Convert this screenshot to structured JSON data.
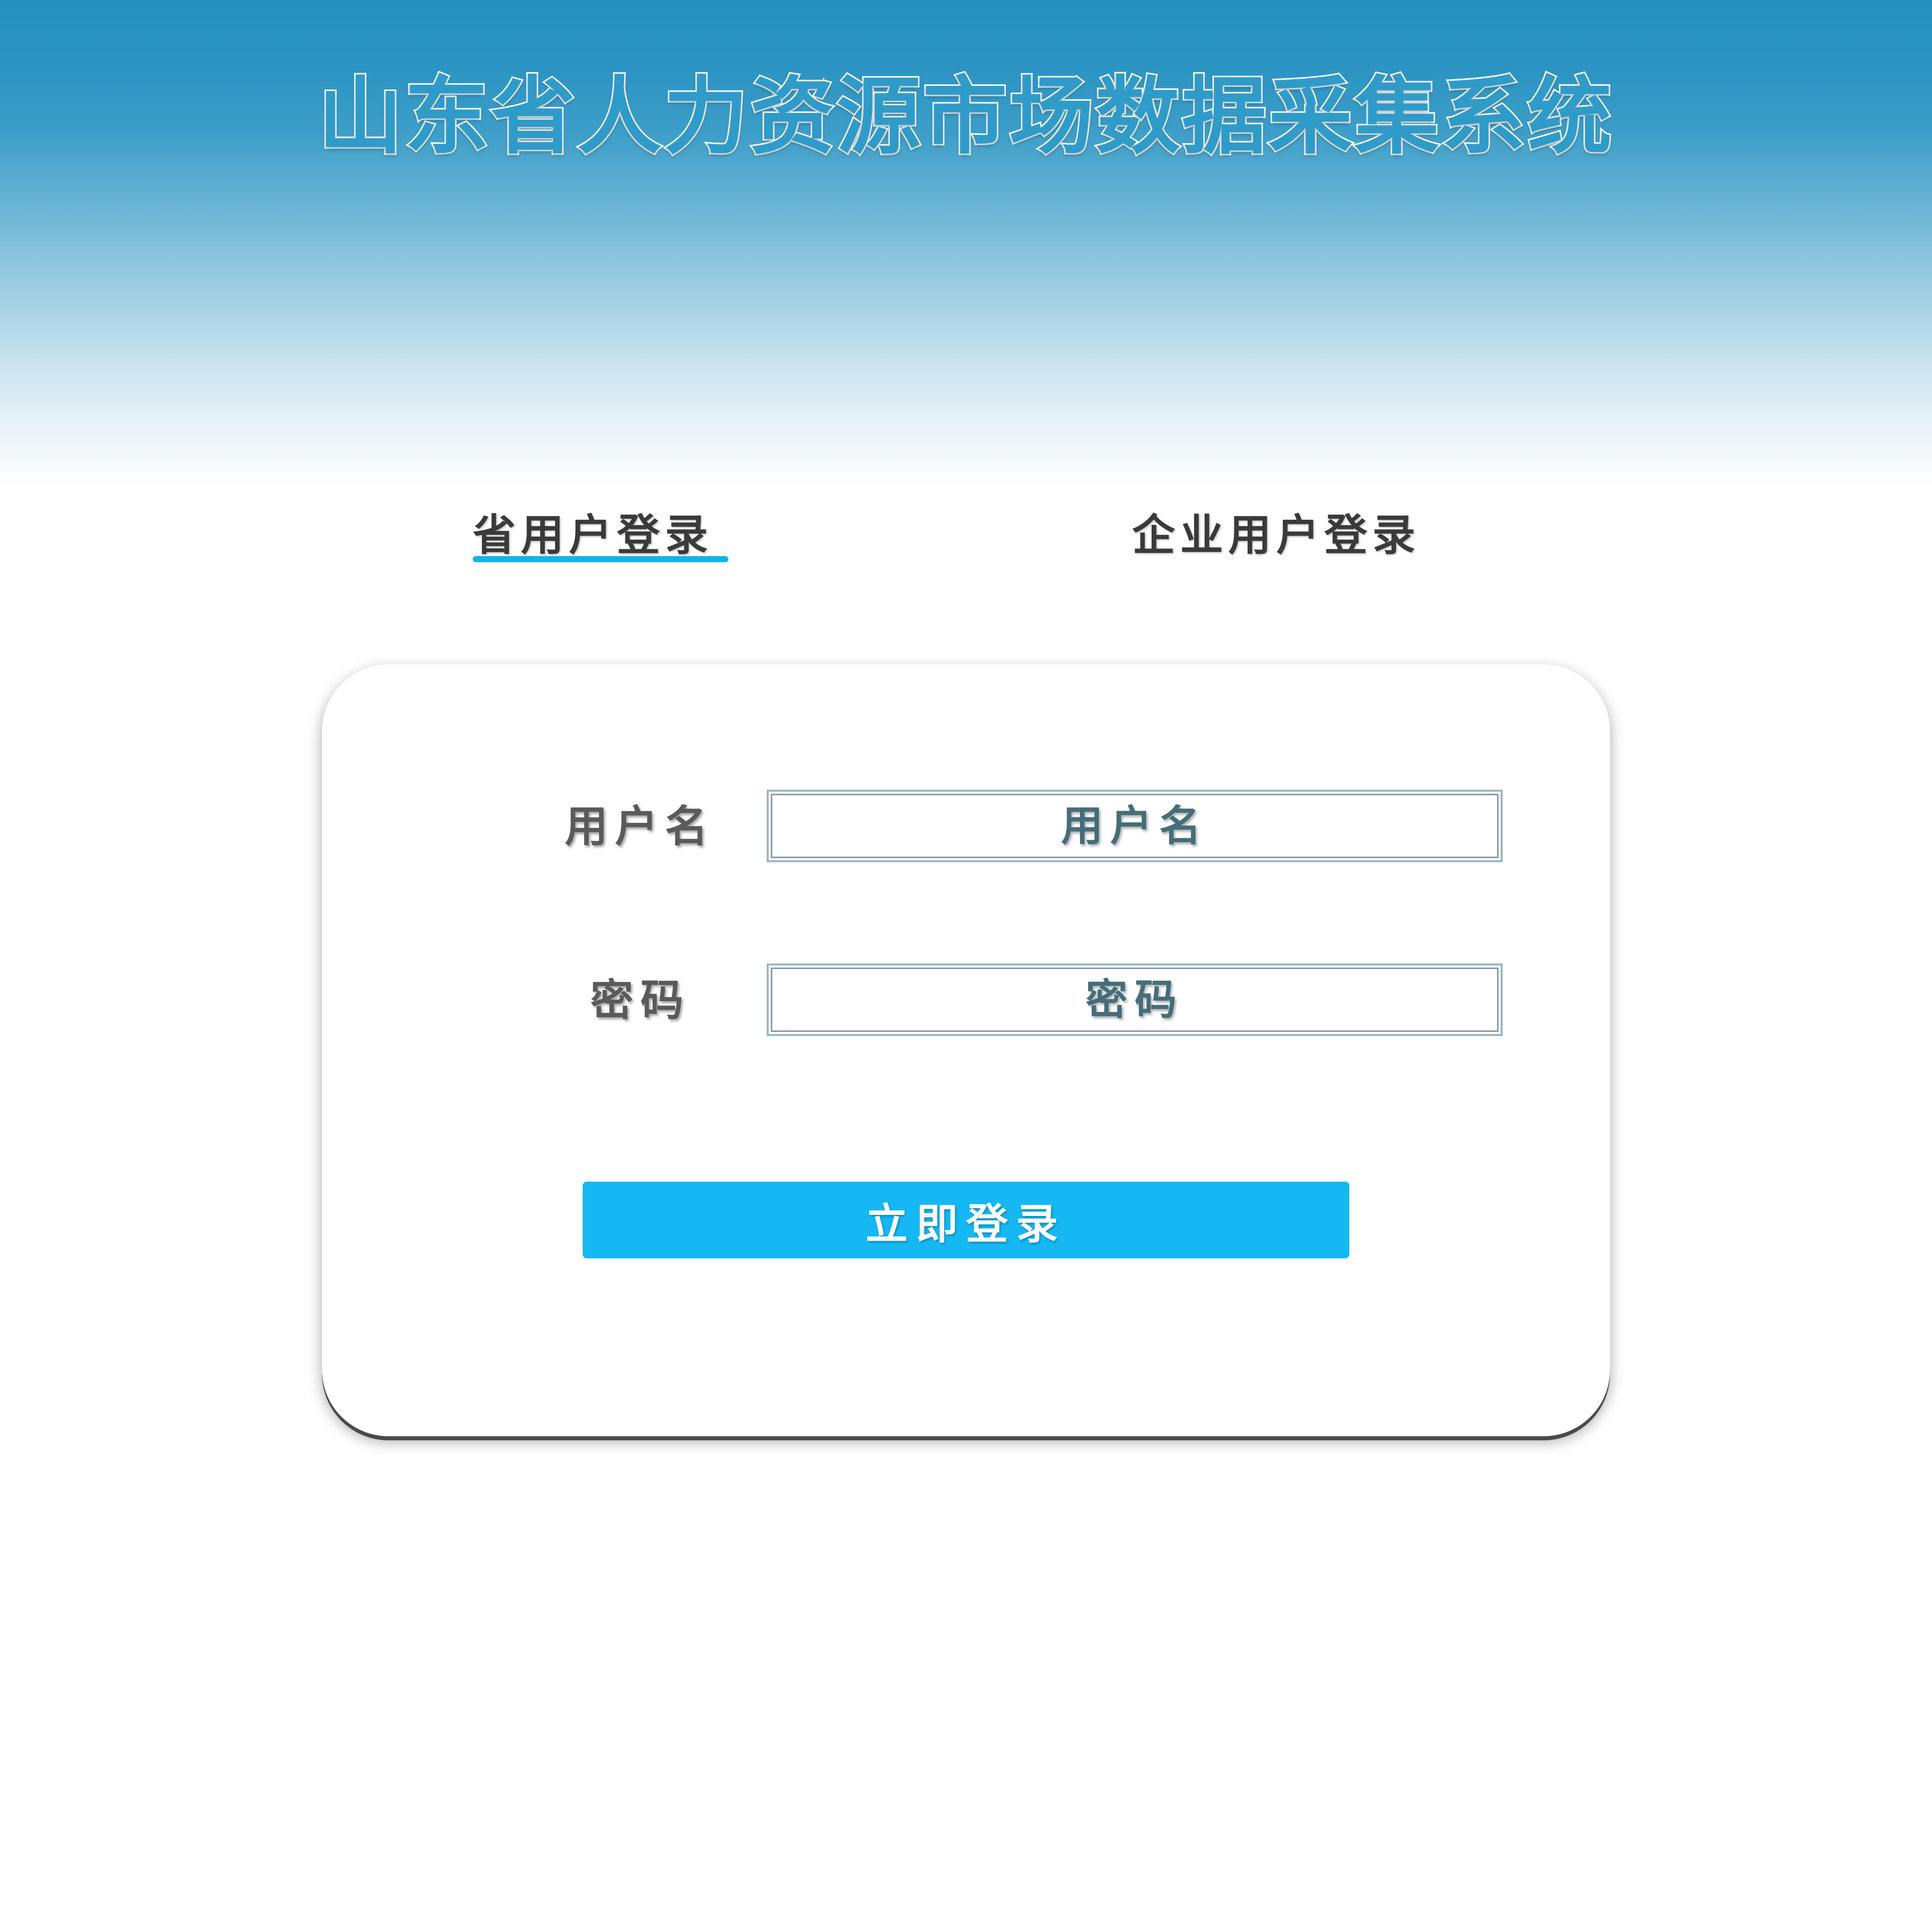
{
  "header": {
    "title": "山东省人力资源市场数据采集系统"
  },
  "tabs": [
    {
      "label": "省用户登录",
      "active": true
    },
    {
      "label": "企业用户登录",
      "active": false
    }
  ],
  "form": {
    "username_label": "用户名",
    "username_placeholder": "用户名",
    "username_value": "",
    "password_label": "密码",
    "password_placeholder": "密码",
    "password_value": "",
    "submit_label": "立即登录"
  },
  "colors": {
    "header_gradient_top": "#2590c0",
    "accent": "#15b8f3",
    "tab_underline": "#12b3ec",
    "text_dark": "#3a3a3a",
    "label_text": "#5a5a5a",
    "input_text": "#456d7a"
  }
}
